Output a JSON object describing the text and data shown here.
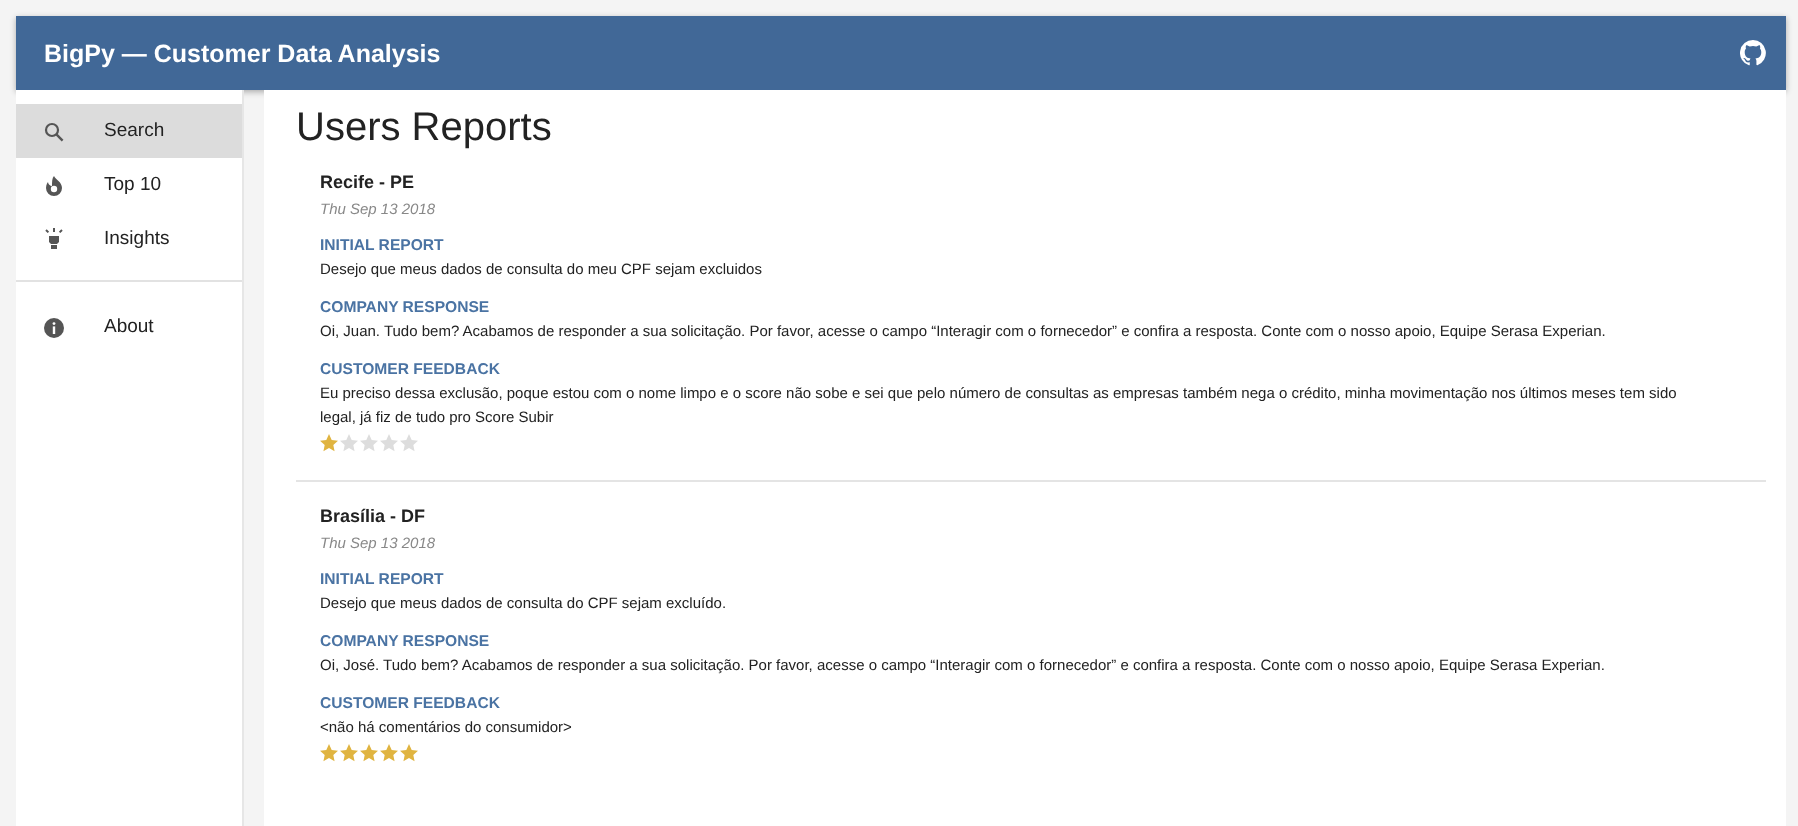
{
  "app_bar": {
    "title": "BigPy — Customer Data Analysis"
  },
  "sidebar": {
    "items": [
      {
        "label": "Search",
        "kind": "search",
        "selected": true
      },
      {
        "label": "Top 10",
        "kind": "fire",
        "selected": false
      },
      {
        "label": "Insights",
        "kind": "bulb",
        "selected": false
      }
    ],
    "secondary_items": [
      {
        "label": "About",
        "kind": "info",
        "selected": false
      }
    ]
  },
  "page_title": "Users Reports",
  "reports": [
    {
      "location": "Recife - PE",
      "date": "Thu Sep 13 2018",
      "sections": [
        {
          "heading": "INITIAL REPORT",
          "text": "Desejo que meus dados de consulta do meu CPF sejam excluidos"
        },
        {
          "heading": "COMPANY RESPONSE",
          "text": "Oi, Juan. Tudo bem? Acabamos de responder a sua solicitação. Por favor, acesse o campo “Interagir com o fornecedor” e confira a resposta. Conte com o nosso apoio, Equipe Serasa Experian."
        },
        {
          "heading": "CUSTOMER FEEDBACK",
          "text": "Eu preciso dessa exclusão, poque estou com o nome limpo e o score não sobe e sei que pelo número de consultas as empresas também nega o crédito, minha movimentação nos últimos meses tem sido legal, já fiz de tudo pro Score Subir"
        }
      ],
      "stars": 1
    },
    {
      "location": "Brasília - DF",
      "date": "Thu Sep 13 2018",
      "sections": [
        {
          "heading": "INITIAL REPORT",
          "text": "Desejo que meus dados de consulta do CPF sejam excluído."
        },
        {
          "heading": "COMPANY RESPONSE",
          "text": "Oi, José. Tudo bem? Acabamos de responder a sua solicitação. Por favor, acesse o campo “Interagir com o fornecedor” e confira a resposta. Conte com o nosso apoio, Equipe Serasa Experian."
        },
        {
          "heading": "CUSTOMER FEEDBACK",
          "text": "<não há comentários do consumidor>"
        }
      ],
      "stars": 5
    }
  ]
}
